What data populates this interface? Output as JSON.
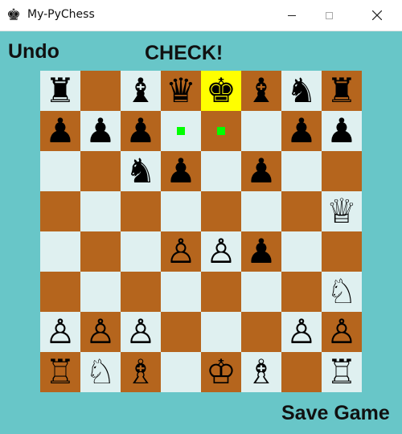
{
  "window": {
    "title": "My-PyChess",
    "app_icon": "chess-king-icon"
  },
  "controls": {
    "undo_label": "Undo",
    "status_label": "CHECK!",
    "save_label": "Save Game"
  },
  "colors": {
    "background": "#68c6c8",
    "light_square": "#dff0f0",
    "dark_square": "#b5651d",
    "check_highlight": "#ffff00",
    "move_hint": "#00ff00"
  },
  "board": {
    "rows": [
      [
        "br",
        "",
        "bb",
        "bq",
        "bk",
        "bb",
        "bn",
        "br"
      ],
      [
        "bp",
        "bp",
        "bp",
        "",
        "",
        "",
        "bp",
        "bp"
      ],
      [
        "",
        "",
        "bn",
        "bp",
        "",
        "bp",
        "",
        ""
      ],
      [
        "",
        "",
        "",
        "",
        "",
        "",
        "",
        "wq"
      ],
      [
        "",
        "",
        "",
        "wp",
        "wp",
        "bp",
        "",
        ""
      ],
      [
        "",
        "",
        "",
        "",
        "",
        "",
        "",
        "wn"
      ],
      [
        "wp",
        "wp",
        "wp",
        "",
        "",
        "",
        "wp",
        "wp"
      ],
      [
        "wr",
        "wn",
        "wb",
        "",
        "wk",
        "wb",
        "",
        "wr"
      ]
    ],
    "check_square": [
      0,
      4
    ],
    "move_hints": [
      [
        1,
        3
      ],
      [
        1,
        4
      ]
    ]
  }
}
